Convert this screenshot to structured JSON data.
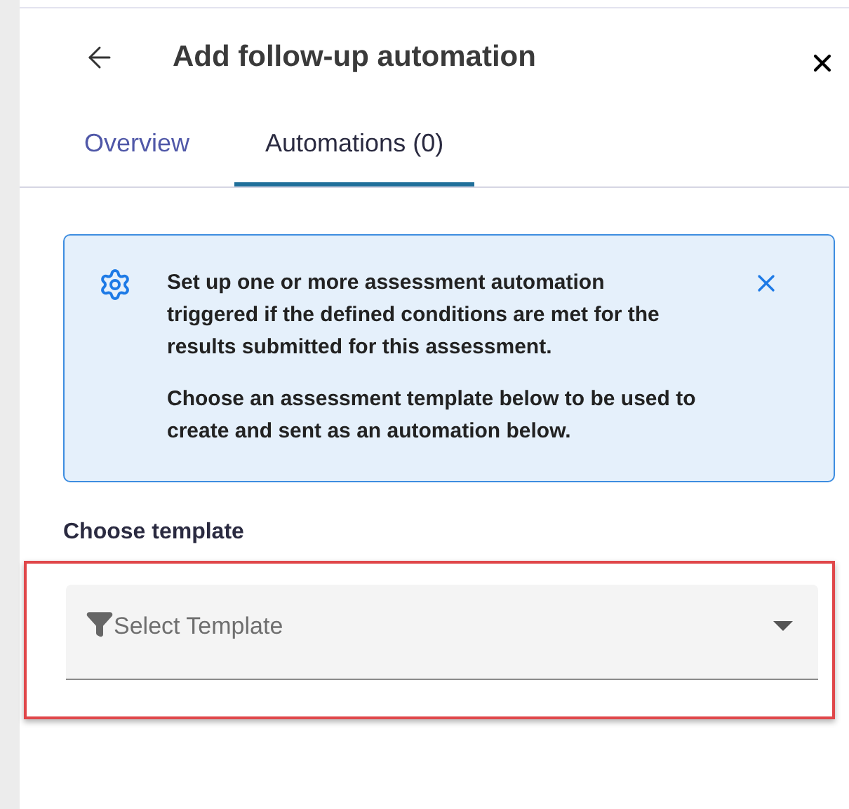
{
  "header": {
    "title": "Add follow-up automation"
  },
  "tabs": [
    {
      "label": "Overview",
      "selected": false
    },
    {
      "label": "Automations (0)",
      "selected": true
    }
  ],
  "info_banner": {
    "paragraphs": [
      "Set up one or more assessment automation triggered if the defined conditions are met for the results submitted for this assessment.",
      "Choose an assessment template below to be used to create and sent as an automation below."
    ]
  },
  "template_field": {
    "label": "Choose template",
    "placeholder": "Select Template",
    "highlighted": true
  }
}
